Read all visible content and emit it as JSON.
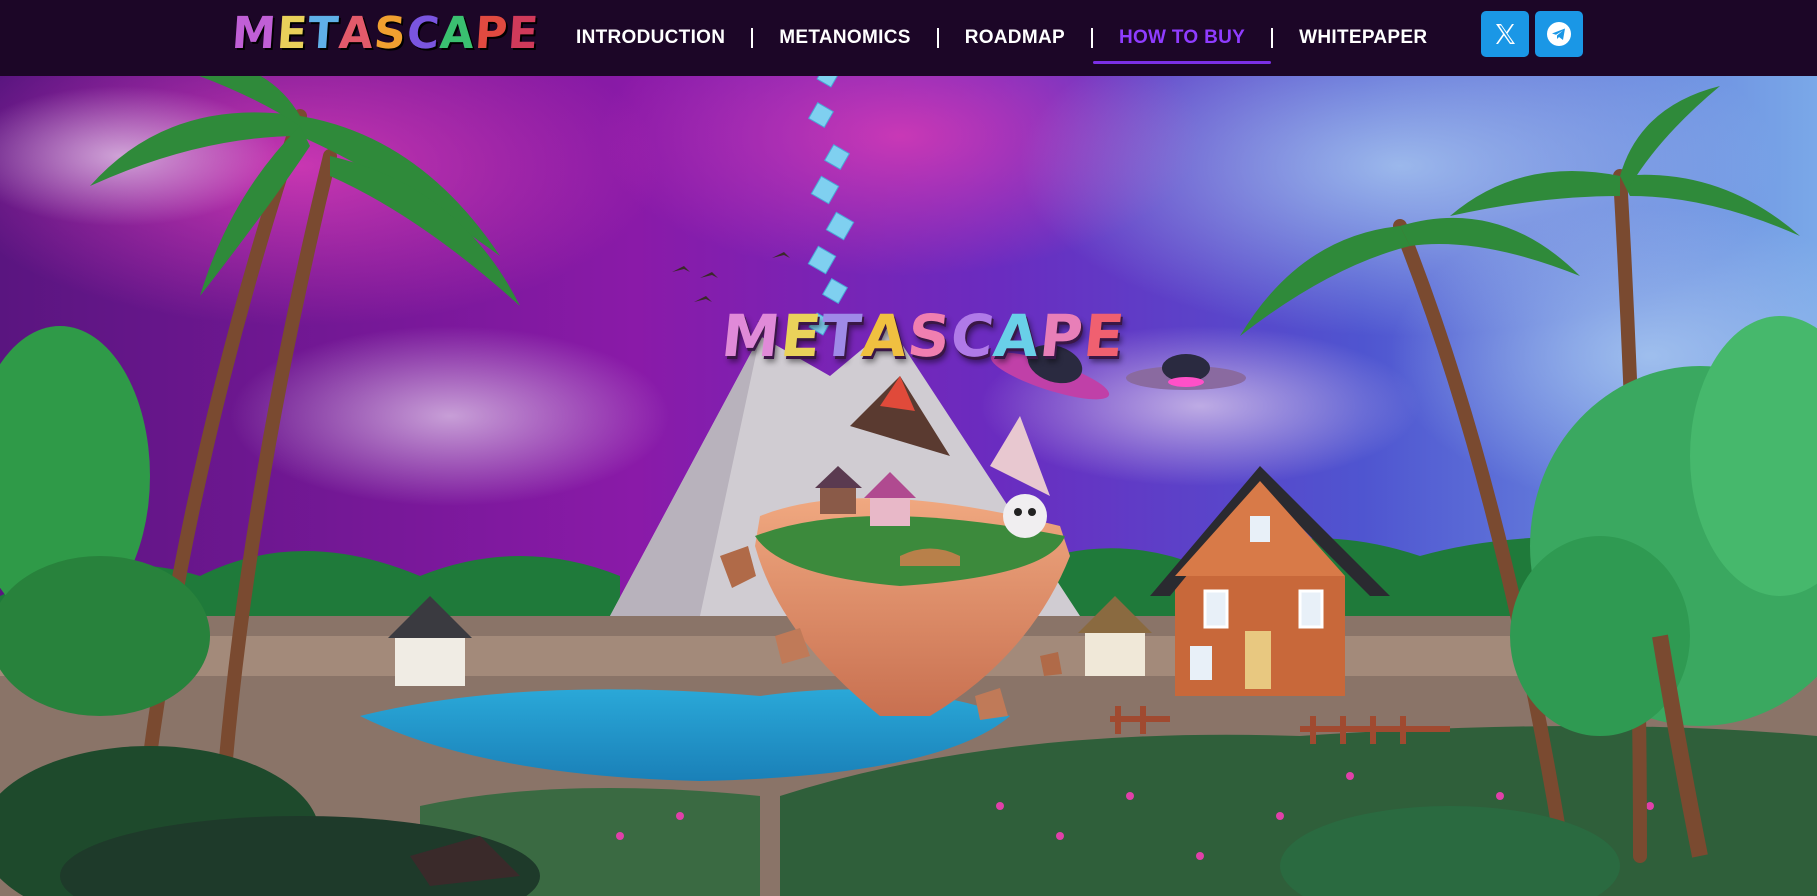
{
  "brand": {
    "name": "METASCAPE",
    "letter_colors": [
      "#c05fd6",
      "#e9d05a",
      "#5fb0e8",
      "#e25a6a",
      "#f0a030",
      "#7a55e0",
      "#3ac070",
      "#e04a40",
      "#d03a5a"
    ]
  },
  "nav": {
    "items": [
      {
        "label": "INTRODUCTION",
        "active": false
      },
      {
        "label": "METANOMICS",
        "active": false
      },
      {
        "label": "ROADMAP",
        "active": false
      },
      {
        "label": "HOW TO BUY",
        "active": true
      },
      {
        "label": "WHITEPAPER",
        "active": false
      }
    ],
    "active_color": "#8f3cff"
  },
  "social": [
    {
      "name": "x-twitter",
      "icon": "x-logo-icon"
    },
    {
      "name": "telegram",
      "icon": "telegram-icon"
    }
  ],
  "hero": {
    "title": "METASCAPE",
    "title_colors": [
      "#e08ad8",
      "#ead25a",
      "#9f8ae8",
      "#f0c040",
      "#f07fb0",
      "#b07ae8",
      "#69d0e8",
      "#e87fb8",
      "#f06070"
    ]
  },
  "colors": {
    "nav_bg": "#1c0627",
    "social_bg": "#1a97e6"
  }
}
